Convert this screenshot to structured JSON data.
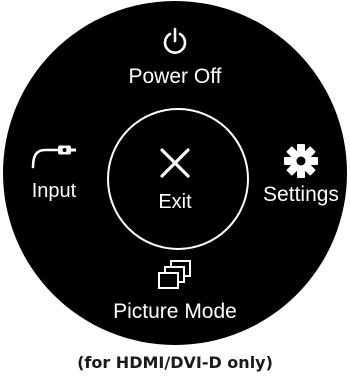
{
  "menu": {
    "power_off": {
      "label": "Power Off",
      "icon": "power-icon"
    },
    "input": {
      "label": "Input",
      "icon": "input-cable-icon"
    },
    "exit": {
      "label": "Exit",
      "icon": "close-icon"
    },
    "settings": {
      "label": "Settings",
      "icon": "gear-icon"
    },
    "picture_mode": {
      "label": "Picture Mode",
      "icon": "picture-mode-icon"
    }
  },
  "footnote": "(for HDMI/DVI-D only)",
  "colors": {
    "disc": "#000000",
    "foreground": "#ffffff",
    "footnote_text": "#1a1a1a"
  }
}
